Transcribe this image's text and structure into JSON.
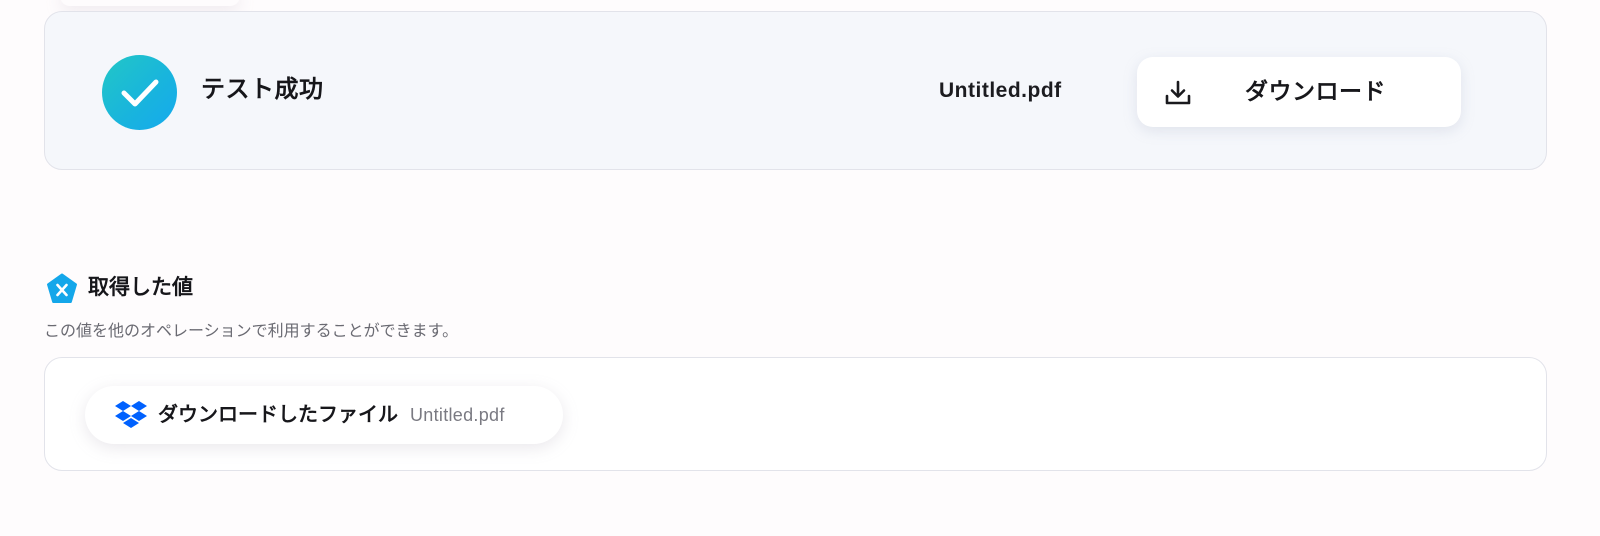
{
  "result": {
    "status_label": "テスト成功",
    "file_name": "Untitled.pdf",
    "download_label": "ダウンロード"
  },
  "values": {
    "title": "取得した値",
    "description": "この値を他のオペレーションで利用することができます。",
    "items": [
      {
        "label": "ダウンロードしたファイル",
        "value": "Untitled.pdf",
        "icon": "dropbox-icon"
      }
    ]
  },
  "colors": {
    "success_badge": "#19b5dc",
    "values_icon": "#14a7ea",
    "dropbox_blue": "#0061fe",
    "card_bg": "#f5f7fb"
  },
  "icons": {
    "status": "check-icon",
    "download": "download-icon",
    "values": "variable-icon"
  }
}
